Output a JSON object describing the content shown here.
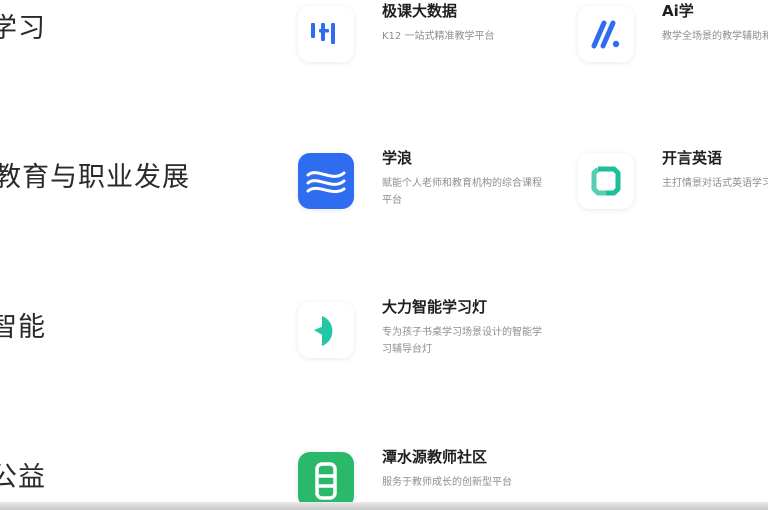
{
  "categories": [
    {
      "label": "学习"
    },
    {
      "label": "教育与职业发展"
    },
    {
      "label": "智能"
    },
    {
      "label": "公益"
    }
  ],
  "products": [
    {
      "name": "极课大数据",
      "desc": "K12 一站式精准教学平台",
      "icon": "jike-bars-icon",
      "color": "#2f6df0"
    },
    {
      "name": "Ai学",
      "desc": "教学全场景的教学辅助和资源平台",
      "icon": "ai-xue-icon",
      "color": "#2f6df0"
    },
    {
      "name": "学浪",
      "desc": "赋能个人老师和教育机构的综合课程平台",
      "icon": "xuelang-waves-icon",
      "color": "#2f6df0"
    },
    {
      "name": "开言英语",
      "desc": "主打情景对话式英语学习App",
      "icon": "kaiyan-icon",
      "color": "#1bbf9a"
    },
    {
      "name": "大力智能学习灯",
      "desc": "专为孩子书桌学习场景设计的智能学习辅导台灯",
      "icon": "dali-lamp-icon",
      "color": "#22c7a6"
    },
    {
      "name": "潭水源教师社区",
      "desc": "服务于教师成长的创新型平台",
      "icon": "tanshuiyuan-icon",
      "color": "#2ab86a"
    }
  ]
}
